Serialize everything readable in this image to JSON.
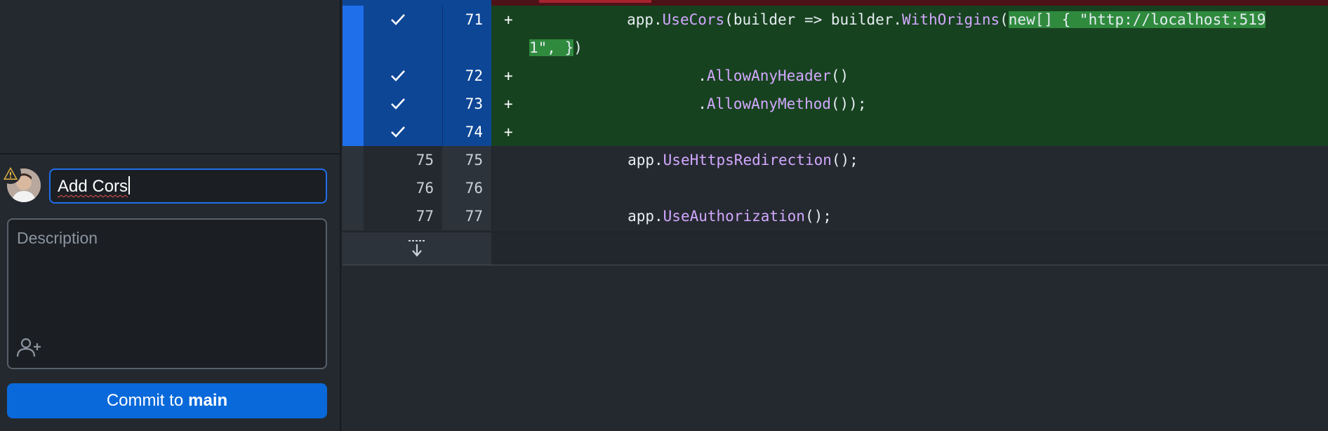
{
  "commit_panel": {
    "summary_value": "Add Cors",
    "description_placeholder": "Description",
    "commit_button": {
      "prefix": "Commit to",
      "branch": "main"
    }
  },
  "diff": {
    "added": [
      {
        "new": "71",
        "indent": "           ",
        "parts": [
          [
            "app.",
            ""
          ],
          [
            "UseCors",
            "fn"
          ],
          [
            "(builder => builder.",
            ""
          ],
          [
            "WithOrigins",
            "fn"
          ],
          [
            "(",
            ""
          ],
          [
            "new[] { \"http://localhost:519",
            "hl"
          ]
        ]
      },
      {
        "new": "",
        "indent": "",
        "wrap": true,
        "parts": [
          [
            "1\", }",
            "hl"
          ],
          [
            ")",
            ""
          ]
        ]
      },
      {
        "new": "72",
        "indent": "                   ",
        "parts": [
          [
            ".",
            ""
          ],
          [
            "AllowAnyHeader",
            "fn"
          ],
          [
            "()",
            ""
          ]
        ]
      },
      {
        "new": "73",
        "indent": "                   ",
        "parts": [
          [
            ".",
            ""
          ],
          [
            "AllowAnyMethod",
            "fn"
          ],
          [
            "());",
            ""
          ]
        ]
      },
      {
        "new": "74",
        "indent": "",
        "parts": []
      }
    ],
    "context": [
      {
        "old": "75",
        "new": "75",
        "indent": "           ",
        "parts": [
          [
            "app.",
            ""
          ],
          [
            "UseHttpsRedirection",
            "fn"
          ],
          [
            "();",
            ""
          ]
        ]
      },
      {
        "old": "76",
        "new": "76",
        "indent": "",
        "parts": []
      },
      {
        "old": "77",
        "new": "77",
        "indent": "           ",
        "parts": [
          [
            "app.",
            ""
          ],
          [
            "UseAuthorization",
            "fn"
          ],
          [
            "();",
            ""
          ]
        ]
      }
    ],
    "added_sign": "+"
  },
  "icons": {
    "warning": "warning-icon",
    "avatar": "avatar",
    "coauthor": "add-coauthor-icon",
    "check": "check-icon",
    "expand": "expand-down-icon"
  },
  "colors": {
    "accent": "#0969da",
    "added_bg": "#17421f",
    "highlight": "#2f8a3e",
    "function": "#d2a8ff"
  }
}
